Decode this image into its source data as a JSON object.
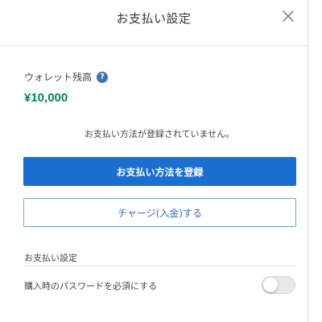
{
  "header": {
    "title": "お支払い設定",
    "close_icon": "close-icon"
  },
  "wallet": {
    "label": "ウォレット残高",
    "help_icon": "?",
    "amount": "¥10,000",
    "amount_color": "#00845a"
  },
  "payment": {
    "empty_message": "お支払い方法が登録されていません。",
    "register_button": "お支払い方法を登録",
    "charge_button": "チャージ(入金)する"
  },
  "settings": {
    "section_title": "お支払い設定",
    "password_required_label": "購入時のパスワードを必須にする",
    "password_required_enabled": false
  },
  "colors": {
    "primary": "#1a6fd0",
    "help_icon": "#3a70b4"
  }
}
